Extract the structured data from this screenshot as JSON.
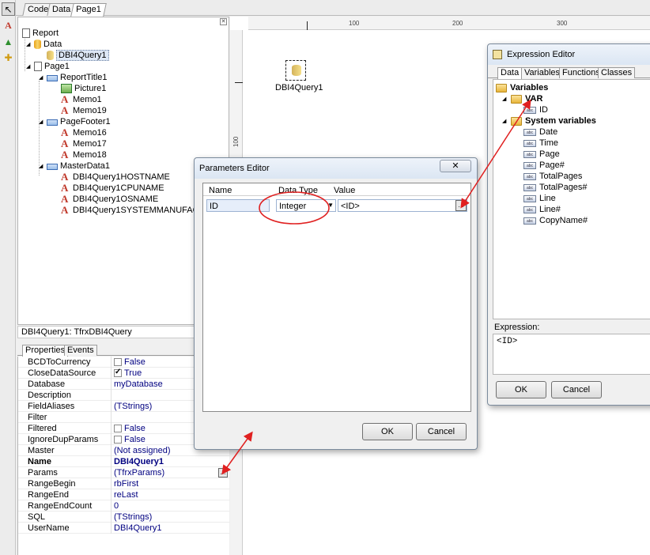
{
  "top_tabs": [
    "Code",
    "Data",
    "Page1"
  ],
  "tree": {
    "items": [
      {
        "label": "Report",
        "icon": "report-icon"
      },
      {
        "label": "Data",
        "icon": "database-icon"
      },
      {
        "label": "DBI4Query1",
        "icon": "query-icon"
      },
      {
        "label": "Page1",
        "icon": "page-icon"
      },
      {
        "label": "ReportTitle1",
        "icon": "band-icon"
      },
      {
        "label": "Picture1",
        "icon": "picture-icon"
      },
      {
        "label": "Memo1",
        "icon": "memo-icon"
      },
      {
        "label": "Memo19",
        "icon": "memo-icon"
      },
      {
        "label": "PageFooter1",
        "icon": "band-icon"
      },
      {
        "label": "Memo16",
        "icon": "memo-icon"
      },
      {
        "label": "Memo17",
        "icon": "memo-icon"
      },
      {
        "label": "Memo18",
        "icon": "memo-icon"
      },
      {
        "label": "MasterData1",
        "icon": "band-icon"
      },
      {
        "label": "DBI4Query1HOSTNAME",
        "icon": "memo-icon"
      },
      {
        "label": "DBI4Query1CPUNAME",
        "icon": "memo-icon"
      },
      {
        "label": "DBI4Query1OSNAME",
        "icon": "memo-icon"
      },
      {
        "label": "DBI4Query1SYSTEMMANUFACTURER",
        "icon": "memo-icon"
      }
    ]
  },
  "object_caption": "DBI4Query1: TfrxDBI4Query",
  "prop_tabs": [
    "Properties",
    "Events"
  ],
  "properties": [
    {
      "name": "BCDToCurrency",
      "value": "False",
      "checkbox": false
    },
    {
      "name": "CloseDataSource",
      "value": "True",
      "checkbox": true
    },
    {
      "name": "Database",
      "value": "myDatabase"
    },
    {
      "name": "Description",
      "value": ""
    },
    {
      "name": "FieldAliases",
      "value": "(TStrings)"
    },
    {
      "name": "Filter",
      "value": ""
    },
    {
      "name": "Filtered",
      "value": "False",
      "checkbox": false
    },
    {
      "name": "IgnoreDupParams",
      "value": "False",
      "checkbox": false
    },
    {
      "name": "Master",
      "value": "(Not assigned)"
    },
    {
      "name": "Name",
      "value": "DBI4Query1",
      "bold": true
    },
    {
      "name": "Params",
      "value": "(TfrxParams)"
    },
    {
      "name": "RangeBegin",
      "value": "rbFirst"
    },
    {
      "name": "RangeEnd",
      "value": "reLast"
    },
    {
      "name": "RangeEndCount",
      "value": "0"
    },
    {
      "name": "SQL",
      "value": "(TStrings)"
    },
    {
      "name": "UserName",
      "value": "DBI4Query1"
    }
  ],
  "ruler": {
    "h_labels": [
      "100",
      "200",
      "300"
    ],
    "v_labels": [
      "100"
    ]
  },
  "design": {
    "component_label": "DBI4Query1"
  },
  "params_editor": {
    "title": "Parameters Editor",
    "columns": [
      "Name",
      "Data Type",
      "Value"
    ],
    "row": {
      "name": "ID",
      "data_type": "Integer",
      "value": "<ID>"
    },
    "ok": "OK",
    "cancel": "Cancel"
  },
  "expression_editor": {
    "title": "Expression Editor",
    "tabs": [
      "Data",
      "Variables",
      "Functions",
      "Classes"
    ],
    "root": "Variables",
    "var_folder": "VAR",
    "var_items": [
      "ID"
    ],
    "sys_folder": "System variables",
    "sys_items": [
      "Date",
      "Time",
      "Page",
      "Page#",
      "TotalPages",
      "TotalPages#",
      "Line",
      "Line#",
      "CopyName#"
    ],
    "expression_label": "Expression:",
    "expression_value": "<ID>",
    "ok": "OK",
    "cancel": "Cancel"
  },
  "colors": {
    "accent_red": "#e02020",
    "value_blue": "#000080"
  }
}
